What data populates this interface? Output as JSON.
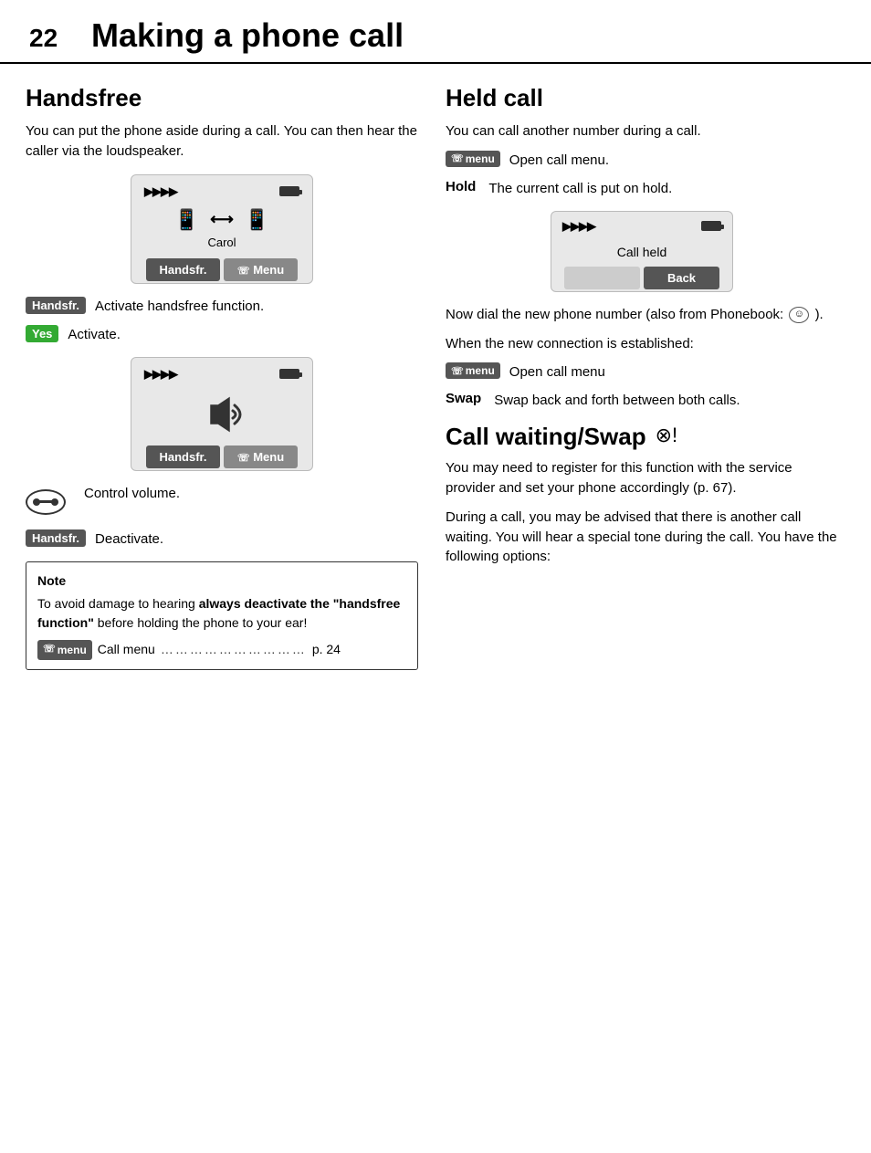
{
  "header": {
    "page_number": "22",
    "title": "Making a phone call"
  },
  "left_col": {
    "section_title": "Handsfree",
    "intro_text": "You can put the phone aside during a call. You can then hear the caller via the loudspeaker.",
    "display1": {
      "signal": ")))))",
      "label": "Carol",
      "btn_left": "Handsfr.",
      "btn_right": "Menu"
    },
    "key1": {
      "badge": "Handsfr.",
      "desc": "Activate handsfree function."
    },
    "key2": {
      "badge": "Yes",
      "desc": "Activate."
    },
    "display2": {
      "signal": ")))))",
      "btn_left": "Handsfr.",
      "btn_right": "Menu"
    },
    "key3": {
      "desc": "Control volume."
    },
    "key4": {
      "badge": "Handsfr.",
      "desc": "Deactivate."
    },
    "note": {
      "title": "Note",
      "text1": "To avoid damage to hearing ",
      "text1_bold": "always deactivate the \"handsfree function\"",
      "text2": " before holding the phone to your ear!",
      "menu_label": "menu",
      "menu_text": "Call menu",
      "dots": "…………………………",
      "page_ref": "p. 24"
    }
  },
  "right_col": {
    "held_section": {
      "title": "Held call",
      "intro": "You can call another number during a call.",
      "key_menu": {
        "badge": "menu",
        "desc": "Open call menu."
      },
      "key_hold": {
        "word": "Hold",
        "desc": "The current call is put on hold."
      },
      "held_display": {
        "signal": ")))))",
        "call_held_text": "Call held",
        "btn_back": "Back"
      },
      "dial_text": "Now dial the new phone number (also from Phonebook:",
      "dial_text2": ").",
      "connection_text": "When the new connection is established:",
      "key_menu2": {
        "badge": "menu",
        "desc": "Open call menu"
      },
      "key_swap": {
        "word": "Swap",
        "desc": "Swap back and forth between both calls."
      }
    },
    "call_waiting_section": {
      "title": "Call waiting/Swap",
      "icon": "⊗!",
      "para1": "You may need to register for this function with the service provider and set your phone accordingly (p. 67).",
      "para2": "During a call, you may be advised that there is another call waiting. You will hear a special tone during the call. You have the following options:"
    }
  }
}
